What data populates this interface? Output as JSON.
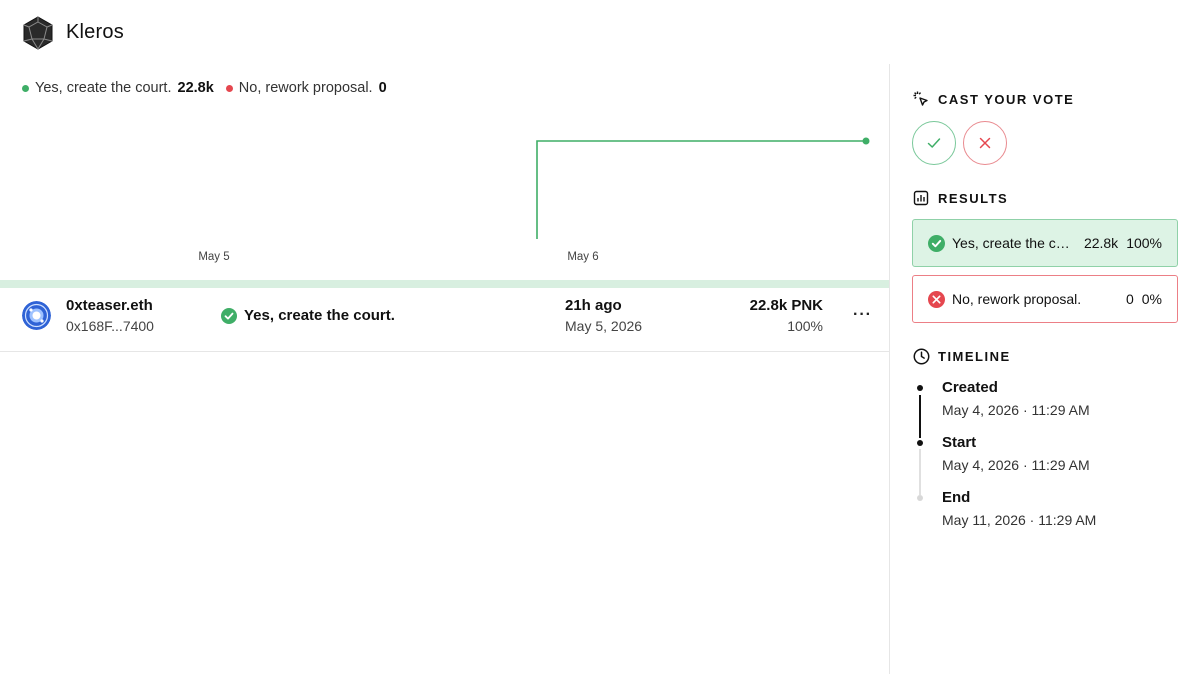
{
  "app": {
    "name": "Kleros"
  },
  "legend": {
    "yes": {
      "label": "Yes, create the court.",
      "value": "22.8k",
      "color": "#3fae67"
    },
    "no": {
      "label": "No, rework proposal.",
      "value": "0",
      "color": "#e5474f"
    }
  },
  "chart_data": {
    "type": "line",
    "x_ticks": [
      "May 5",
      "May 6"
    ],
    "series": [
      {
        "name": "Yes, create the court.",
        "x": [
          "May 6",
          "May 7"
        ],
        "y": [
          22.8,
          22.8
        ],
        "color": "#3fae67"
      }
    ],
    "xlabel": "",
    "ylabel": "",
    "grid": false
  },
  "votes": [
    {
      "voter": "0xteaser.eth",
      "address": "0x168F...7400",
      "choice": "Yes, create the court.",
      "time_ago": "21h ago",
      "date": "May 5, 2026",
      "amount": "22.8k PNK",
      "percent": "100%",
      "more": "···"
    }
  ],
  "sidebar": {
    "cast_title": "CAST YOUR VOTE",
    "results_title": "RESULTS",
    "results": [
      {
        "label": "Yes, create the court.",
        "value": "22.8k",
        "percent": "100%"
      },
      {
        "label": "No, rework proposal.",
        "value": "0",
        "percent": "0%"
      }
    ],
    "timeline_title": "TIMELINE",
    "timeline": [
      {
        "title": "Created",
        "date": "May 4, 2026 · 11:29 AM"
      },
      {
        "title": "Start",
        "date": "May 4, 2026 · 11:29 AM"
      },
      {
        "title": "End",
        "date": "May 11, 2026 · 11:29 AM"
      }
    ]
  },
  "colors": {
    "yes": "#3fae67",
    "no": "#e5474f",
    "border": "#e6e6e6"
  },
  "icons": {
    "logo": "kleros-logo-icon",
    "cursor": "cursor-click-icon",
    "results": "bar-chart-icon",
    "timeline": "clock-icon",
    "yes": "check-circle-icon",
    "no": "x-circle-icon",
    "more": "more-horizontal-icon"
  }
}
